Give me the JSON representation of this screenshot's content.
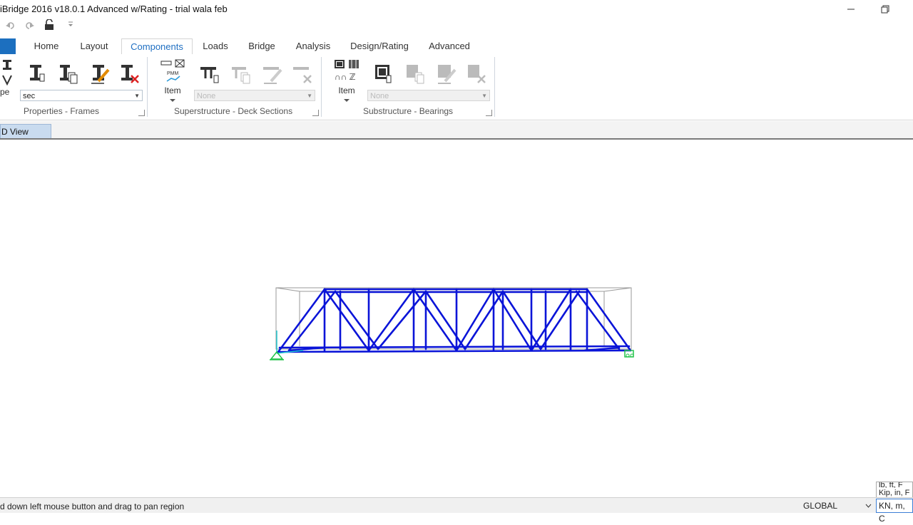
{
  "window": {
    "title": "iBridge 2016 v18.0.1 Advanced w/Rating  - trial wala feb",
    "minimize_icon": "minimize-icon",
    "restore_icon": "restore-icon"
  },
  "quick_access": {
    "icons": [
      "undo-icon",
      "redo-icon",
      "lock-icon",
      "customize-arrow-icon"
    ]
  },
  "tabs": [
    {
      "label": "Home"
    },
    {
      "label": "Layout"
    },
    {
      "label": "Components",
      "active": true
    },
    {
      "label": "Loads"
    },
    {
      "label": "Bridge"
    },
    {
      "label": "Analysis"
    },
    {
      "label": "Design/Rating"
    },
    {
      "label": "Advanced"
    }
  ],
  "ribbon": {
    "properties_frames": {
      "type_label_partial": "pe",
      "section_combo_value": "sec",
      "group_label": "Properties - Frames"
    },
    "superstructure": {
      "item_label": "Item",
      "combo_value": "None",
      "group_label": "Superstructure - Deck Sections"
    },
    "substructure": {
      "item_label": "Item",
      "combo_value": "None",
      "group_label": "Substructure - Bearings"
    }
  },
  "view": {
    "tab_label": "D View"
  },
  "status": {
    "message": "d down left mouse button and drag to pan region",
    "coordinate_system": "GLOBAL",
    "units_options": [
      "lb, ft, F",
      "Kip, in, F"
    ],
    "units_selected": "KN, m, C"
  },
  "colors": {
    "ribbon_accent": "#1f6fc2",
    "truss_member": "#0a14d8",
    "bounding_box": "#9a9a9a",
    "support": "#22c44a"
  }
}
